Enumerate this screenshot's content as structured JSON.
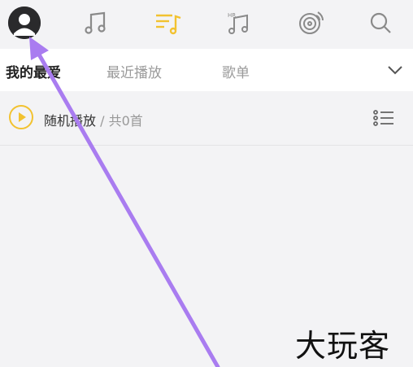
{
  "topbar": {
    "icons": [
      "avatar",
      "music-note-icon",
      "playlist-icon",
      "hifi-music-icon",
      "radio-disc-icon",
      "search-icon"
    ],
    "active_color": "#f2c230",
    "icon_color": "#8a8a8a"
  },
  "tabs": {
    "items": [
      "我的最爱",
      "最近播放",
      "歌单"
    ],
    "active_index": 0
  },
  "shuffle": {
    "label": "随机播放",
    "separator": " / ",
    "count": "共0首",
    "accent": "#f2c230"
  },
  "watermark": "大玩客",
  "annotation": {
    "type": "arrow",
    "color": "#a97cf0",
    "points_to": "avatar"
  }
}
